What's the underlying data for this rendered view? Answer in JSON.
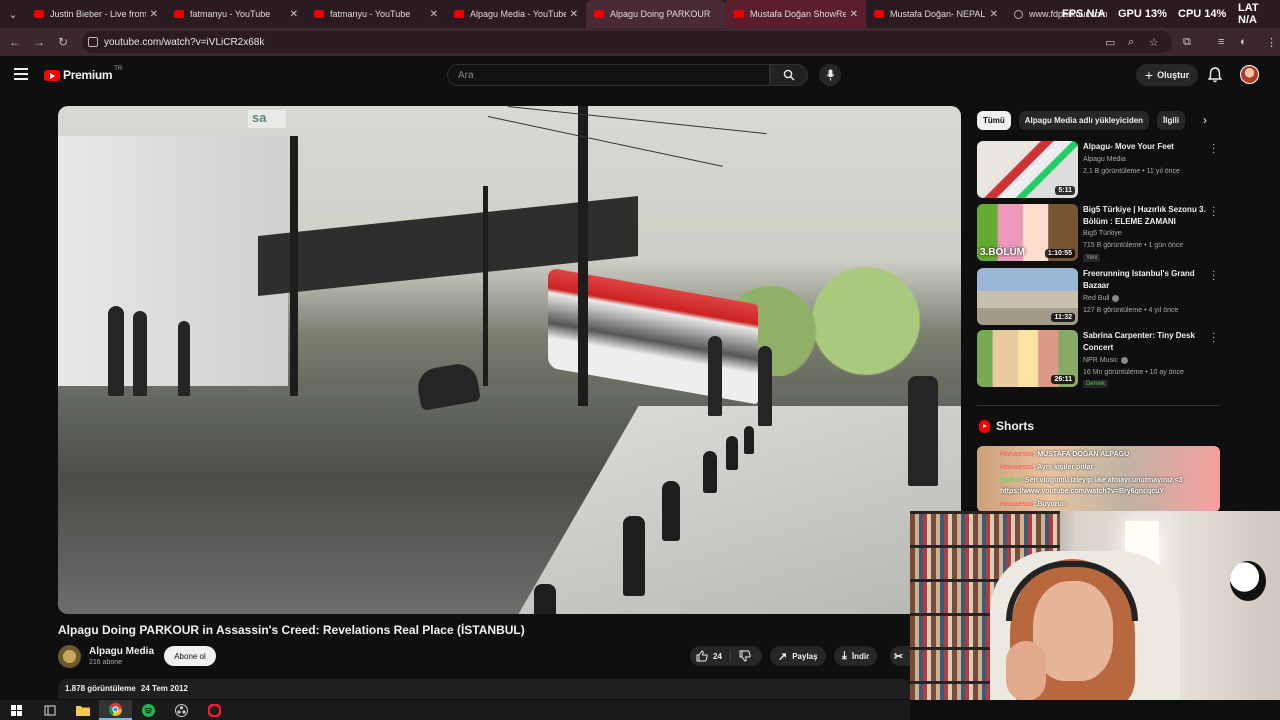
{
  "browser": {
    "tabs": [
      {
        "title": "Justin Bieber - Live from",
        "favicon": "youtube-icon"
      },
      {
        "title": "fatmanyu - YouTube",
        "favicon": "youtube-icon"
      },
      {
        "title": "fatmanyu - YouTube",
        "favicon": "youtube-icon"
      },
      {
        "title": "Alpagu Media - YouTube",
        "favicon": "youtube-icon"
      },
      {
        "title": "Alpagu Doing PARKOUR",
        "favicon": "youtube-icon",
        "active": true
      },
      {
        "title": "Mustafa Doğan ShowRe",
        "favicon": "youtube-icon"
      },
      {
        "title": "Mustafa Doğan- NEPALES",
        "favicon": "youtube-icon"
      },
      {
        "title": "www.fdparkour.com",
        "favicon": "globe-icon"
      }
    ],
    "hud": {
      "fps": "FPS N/A",
      "gpu": "GPU 13%",
      "cpu": "CPU 14%",
      "lat": "LAT N/A"
    },
    "url": "youtube.com/watch?v=iVLiCR2x68k"
  },
  "youtube": {
    "logo_text": "Premium",
    "country": "TR",
    "search_placeholder": "Ara",
    "create_label": "Oluştur"
  },
  "video": {
    "title": "Alpagu Doing PARKOUR in Assassin's Creed: Revelations Real Place (İSTANBUL)",
    "channel": "Alpagu Media",
    "subscribers": "216 abone",
    "subscribe_label": "Abone ol",
    "likes": "24",
    "share_label": "Paylaş",
    "download_label": "İndir",
    "views": "1.878 görüntüleme",
    "date": "24 Tem 2012",
    "frame_sign": "sa"
  },
  "sidebar": {
    "chips": [
      "Tümü",
      "Alpagu Media adlı yükleyiciden",
      "İlgili"
    ],
    "recommendations": [
      {
        "title": "Alpagu- Move Your Feet",
        "channel": "Alpagu Media",
        "meta": "2,1 B görüntüleme • 11 yıl önce",
        "duration": "5:11"
      },
      {
        "title": "Big5 Türkiye | Hazırlık Sezonu 3. Bölüm : ELEME ZAMANI",
        "channel": "Big5 Türkiye",
        "meta": "715 B görüntüleme • 1 gün önce",
        "duration": "1:10:55",
        "badge": "Yeni",
        "thumb_text": "3.BÖLÜM"
      },
      {
        "title": "Freerunning Istanbul's Grand Bazaar",
        "channel": "Red Bull",
        "meta": "127 B görüntüleme • 4 yıl önce",
        "duration": "11:32",
        "verified": true
      },
      {
        "title": "Sabrina Carpenter: Tiny Desk Concert",
        "channel": "NPR Music",
        "meta": "16 Mn görüntüleme • 10 ay önce",
        "duration": "26:11",
        "badge": "Demek",
        "verified": true
      }
    ],
    "shorts_label": "Shorts"
  },
  "chat": [
    {
      "user": "Horusesss",
      "text": ": MUSTAFA DOĞAN ALPAGU"
    },
    {
      "user": "Horusesss",
      "text": ": Aynı kişiler onlar"
    },
    {
      "user": "BotRix",
      "text": ": Sen vlogumu izleyip like atmayı unutmayınız <3",
      "bot": true
    },
    {
      "user": "",
      "text": "https://www.youtube.com/watch?v=Bry6qncqcuY"
    },
    {
      "user": "Horusesss",
      "text": ": Buyurun"
    }
  ],
  "colors": {
    "youtube_red": "#ff0000",
    "background": "#0f0f0f",
    "tabstrip": "#2b1a22"
  }
}
